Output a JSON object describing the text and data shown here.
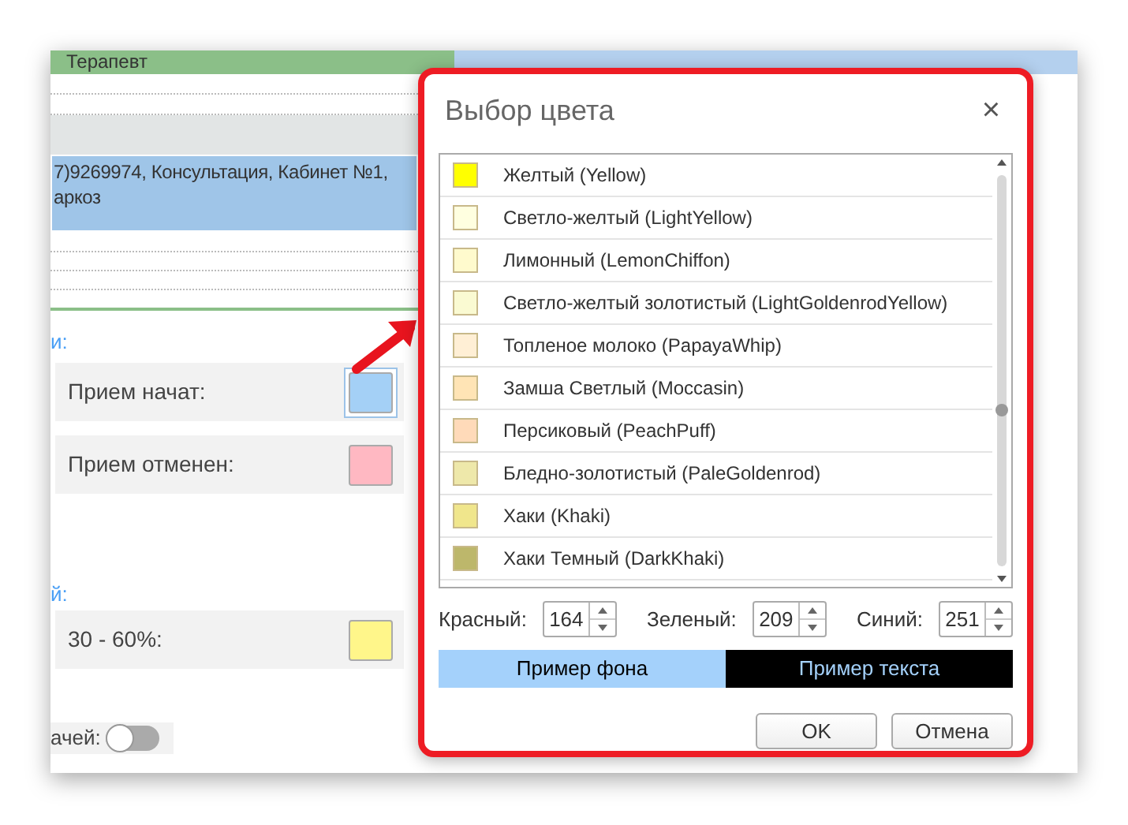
{
  "background": {
    "header": {
      "label": "Терапевт"
    },
    "appointment": {
      "lines": [
        "7)9269974, Консультация, Кабинет №1,",
        "аркоз"
      ]
    },
    "section_1_label": "и:",
    "settings_1": [
      {
        "label": "Прием начат:",
        "color": "#a4d0f6",
        "selected": true
      },
      {
        "label": "Прием отменен:",
        "color": "#ffb8c2",
        "selected": false
      }
    ],
    "section_2_label": "й:",
    "settings_2": [
      {
        "label": "30 - 60%:",
        "color": "#fff68a",
        "selected": false
      }
    ],
    "toggle": {
      "label": "ачей:",
      "on": false
    }
  },
  "dialog": {
    "title": "Выбор цвета",
    "close": "×",
    "colors": [
      {
        "name": "Желтый (Yellow)",
        "color": "#ffff00"
      },
      {
        "name": "Светло-желтый (LightYellow)",
        "color": "#ffffe0"
      },
      {
        "name": "Лимонный (LemonChiffon)",
        "color": "#fffacd"
      },
      {
        "name": "Светло-желтый золотистый (LightGoldenrodYellow)",
        "color": "#fafad2"
      },
      {
        "name": "Топленое молоко (PapayaWhip)",
        "color": "#ffefd5"
      },
      {
        "name": "Замша Светлый (Moccasin)",
        "color": "#ffe4b5"
      },
      {
        "name": "Персиковый (PeachPuff)",
        "color": "#ffdab9"
      },
      {
        "name": "Бледно-золотистый (PaleGoldenrod)",
        "color": "#eee8aa"
      },
      {
        "name": "Хаки (Khaki)",
        "color": "#f0e68c"
      },
      {
        "name": "Хаки Темный (DarkKhaki)",
        "color": "#bdb76b"
      }
    ],
    "rgb": [
      {
        "label": "Красный:",
        "value": "164"
      },
      {
        "label": "Зеленый:",
        "value": "209"
      },
      {
        "label": "Синий:",
        "value": "251"
      }
    ],
    "preview": {
      "background_label": "Пример фона",
      "text_label": "Пример текста"
    },
    "buttons": [
      "OK",
      "Отмена"
    ]
  }
}
